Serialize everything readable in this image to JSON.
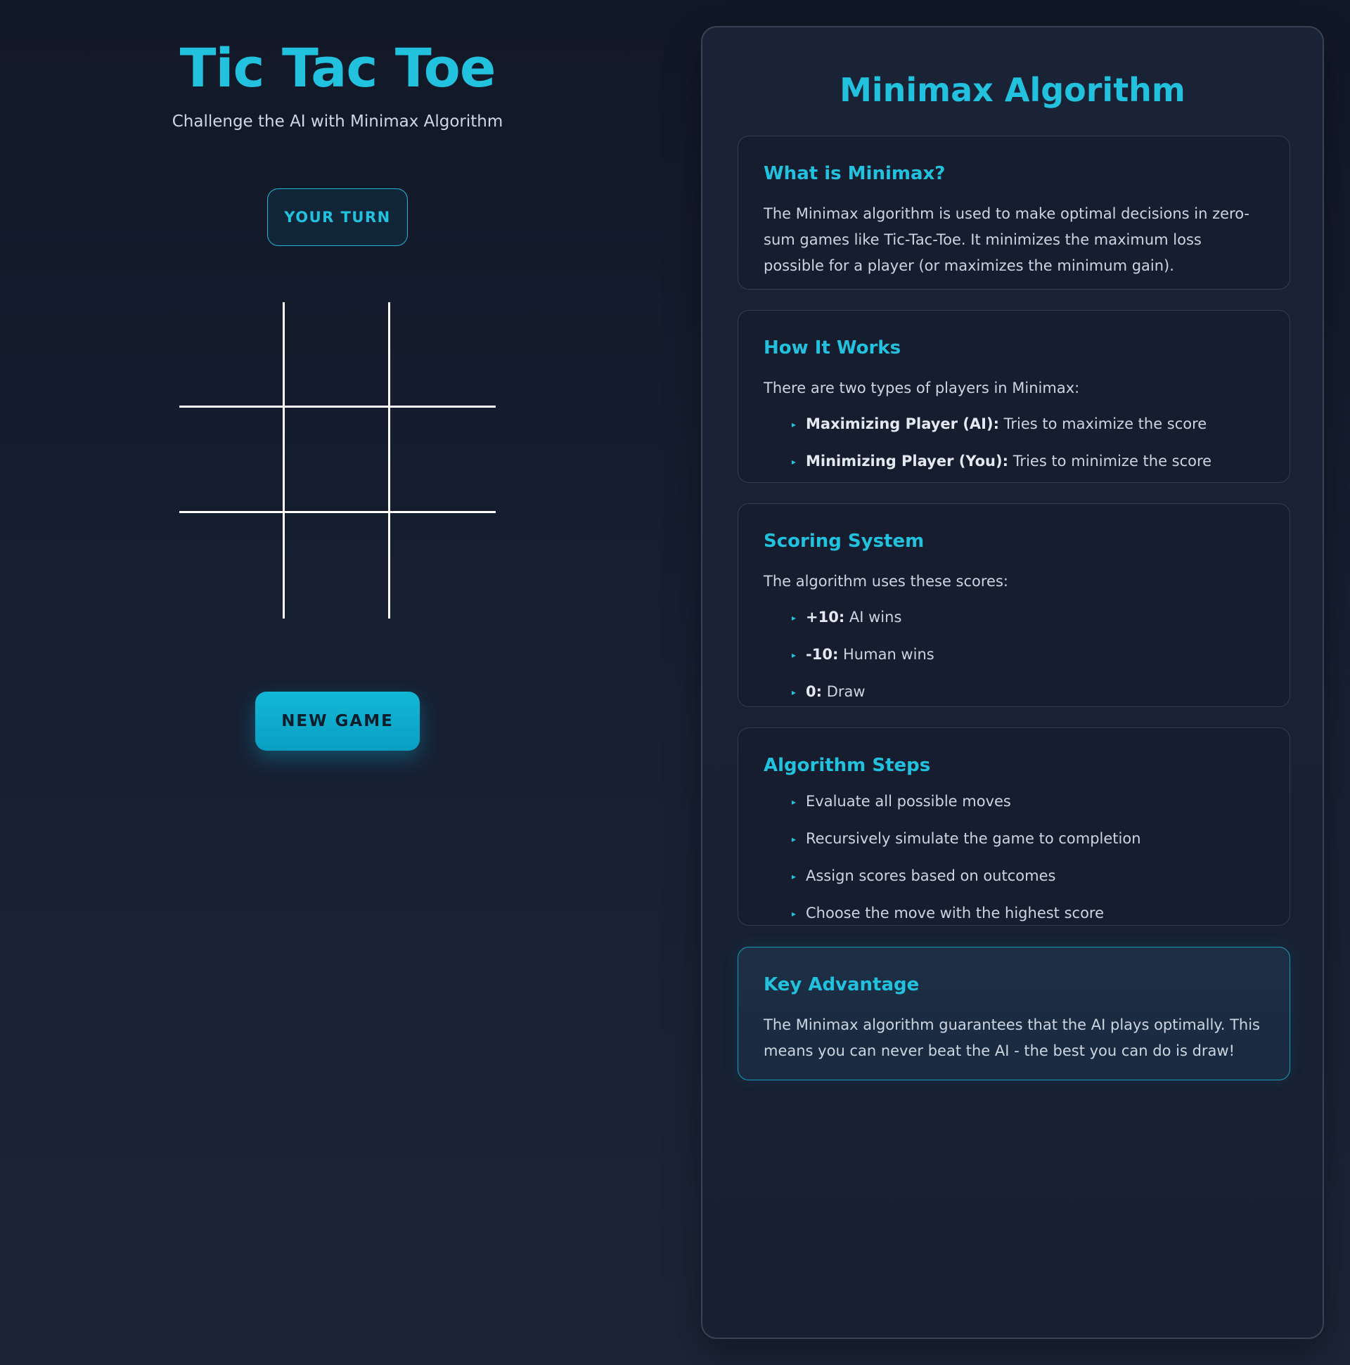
{
  "game": {
    "title": "Tic Tac Toe",
    "subtitle": "Challenge the AI with Minimax Algorithm",
    "status": "YOUR TURN",
    "board": [
      "",
      "",
      "",
      "",
      "",
      "",
      "",
      "",
      ""
    ],
    "new_game_label": "NEW GAME"
  },
  "panel": {
    "title": "Minimax Algorithm",
    "what": {
      "heading": "What is Minimax?",
      "body": "The Minimax algorithm is used to make optimal decisions in zero-sum games like Tic-Tac-Toe. It minimizes the maximum loss possible for a player (or maximizes the minimum gain)."
    },
    "how": {
      "heading": "How It Works",
      "intro": "There are two types of players in Minimax:",
      "items": [
        {
          "term": "Maximizing Player (AI):",
          "desc": " Tries to maximize the score"
        },
        {
          "term": "Minimizing Player (You):",
          "desc": " Tries to minimize the score"
        }
      ]
    },
    "scoring": {
      "heading": "Scoring System",
      "intro": "The algorithm uses these scores:",
      "items": [
        {
          "term": "+10:",
          "desc": " AI wins"
        },
        {
          "term": "-10:",
          "desc": " Human wins"
        },
        {
          "term": "0:",
          "desc": " Draw"
        }
      ]
    },
    "steps": {
      "heading": "Algorithm Steps",
      "items": [
        "Evaluate all possible moves",
        "Recursively simulate the game to completion",
        "Assign scores based on outcomes",
        "Choose the move with the highest score"
      ]
    },
    "advantage": {
      "heading": "Key Advantage",
      "body": "The Minimax algorithm guarantees that the AI plays optimally. This means you can never beat the AI - the best you can do is draw!"
    }
  },
  "icons": {
    "bullet": "triangle-right-icon"
  },
  "colors": {
    "accent": "#22c2df",
    "background": "#131b2c",
    "button": "#0ab2d2"
  }
}
